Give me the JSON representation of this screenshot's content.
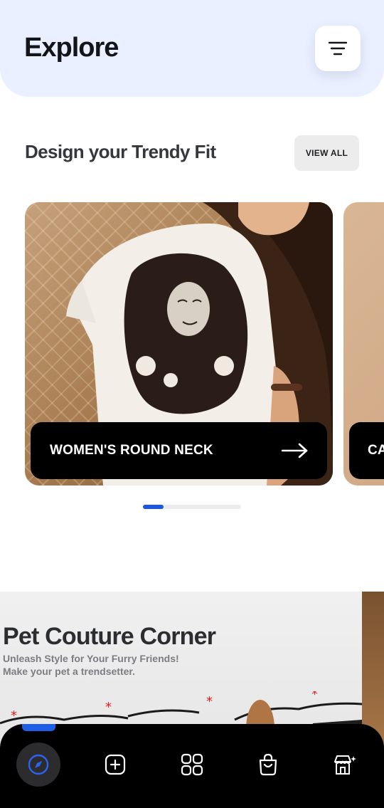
{
  "header": {
    "title": "Explore",
    "menu_icon": "menu-lines-icon"
  },
  "section": {
    "title": "Design your Trendy Fit",
    "view_all_label": "VIEW ALL"
  },
  "carousel": {
    "cards": [
      {
        "label": "WOMEN'S ROUND NECK",
        "icon": "arrow-right-icon"
      },
      {
        "label": "CA"
      }
    ],
    "pager": {
      "active_index": 0,
      "total": 5
    }
  },
  "banner": {
    "title": "Pet Couture Corner",
    "subtitle_line1": "Unleash Style for Your Furry Friends!",
    "subtitle_line2": "Make your pet a trendsetter."
  },
  "bottom_nav": {
    "items": [
      {
        "icon": "compass-icon",
        "active": true
      },
      {
        "icon": "add-square-icon",
        "active": false
      },
      {
        "icon": "grid-icon",
        "active": false
      },
      {
        "icon": "shopping-bag-icon",
        "active": false
      },
      {
        "icon": "store-sparkle-icon",
        "active": false
      }
    ]
  },
  "colors": {
    "header_bg": "#eaf0ff",
    "accent": "#1b57e0",
    "nav_bg": "#000000",
    "star": "#e32020"
  }
}
